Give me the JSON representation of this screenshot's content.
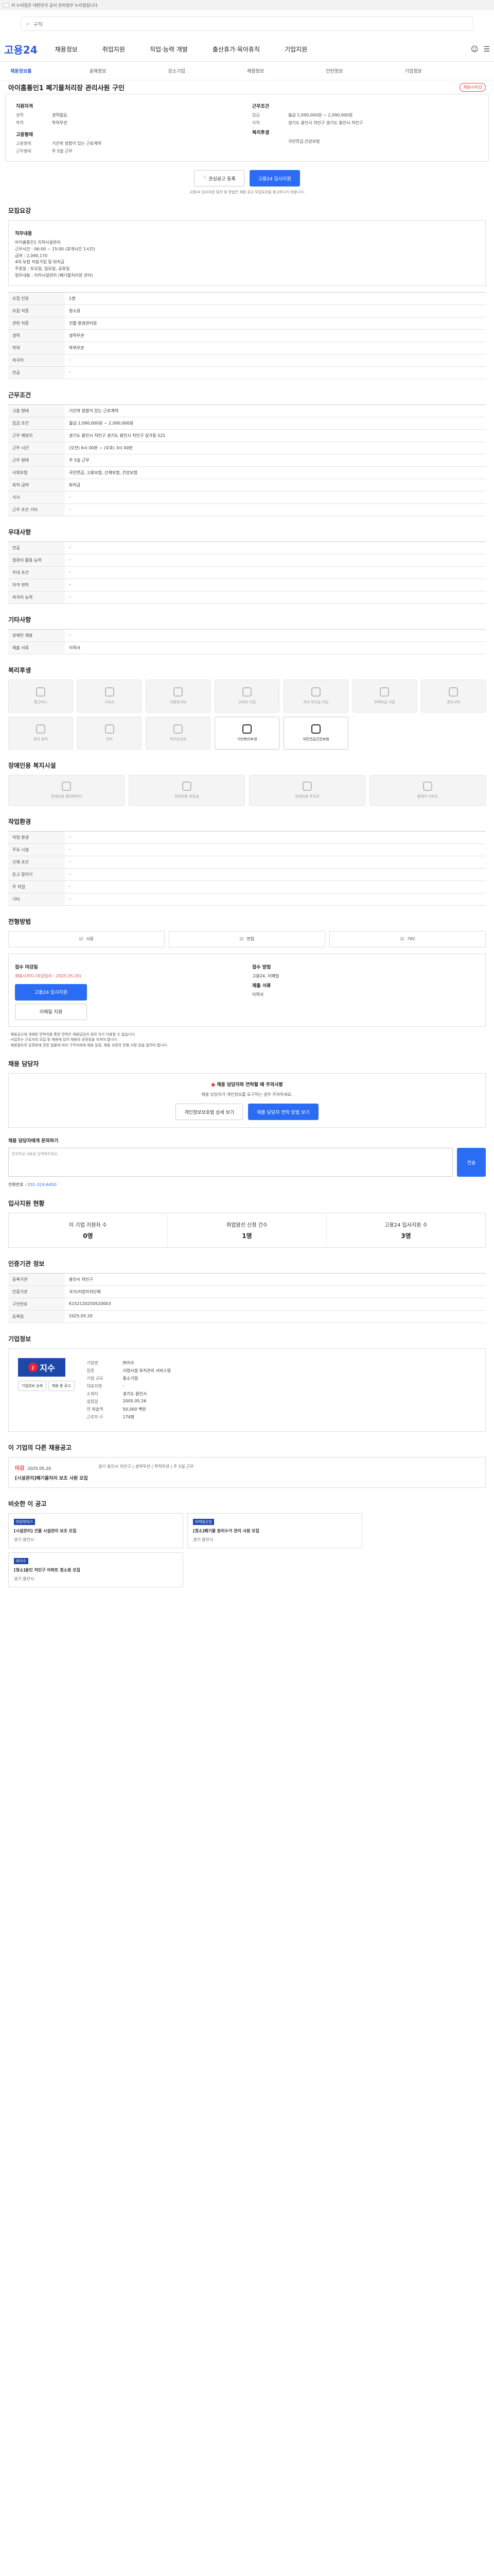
{
  "gov_bar": "이 누리집은 대한민국 공식 전자정부 누리집입니다.",
  "search": {
    "placeholder": "구직"
  },
  "logo": "고용24",
  "nav": [
    "채용정보",
    "취업지원",
    "직업·능력 개발",
    "출산휴가·육아휴직",
    "기업지원"
  ],
  "subnav": [
    "채용정보홈",
    "공채정보",
    "강소기업",
    "체험정보",
    "인턴정보",
    "기업정보"
  ],
  "title": "아이홈통인1 폐기물처리장 관리사원 구인",
  "title_badge": "채용시마감",
  "summary": {
    "left_label": "지원자격",
    "left": [
      [
        "경력",
        "경력없음"
      ],
      [
        "학력",
        "학력무관"
      ],
      [
        "",
        ""
      ]
    ],
    "left2_label": "고용형태",
    "left2": [
      [
        "고용형태",
        "기간의 정함이 있는 근로계약"
      ],
      [
        "근무형태",
        "주 5일 근무"
      ]
    ],
    "right_label": "근무조건",
    "right": [
      [
        "임금",
        "월급 2,090,000원 ~ 2,090,000원"
      ],
      [
        "지역",
        "경기도 용인시 처인구 경기도 용인시 처인구"
      ]
    ],
    "right2_label": "복리후생",
    "right2": [
      [
        "",
        "국민연금,건강보험"
      ]
    ]
  },
  "buttons": {
    "scrap": "관심공고 등록",
    "apply": "고용24 입사지원"
  },
  "apply_note": "고용24 입사지원 절차 및 방법은 채용 공고 모집요강을 참고하시기 바랍니다.",
  "sections": {
    "job_info": "모집요강",
    "conditions": "근무조건",
    "welfare_title": "우대사항",
    "other": "기타사항",
    "benefits": "복리후생",
    "disabled": "장애인용 복지시설",
    "work_env": "작업환경",
    "apply_method": "전형방법",
    "contact": "채용 담당자",
    "status": "입사지원 현황",
    "agency_info": "인증기관 정보",
    "company": "기업정보",
    "same_company": "이 기업의 다른 채용공고",
    "similar": "비슷한 이 공고"
  },
  "job_desc": {
    "label": "직무내용",
    "lines": [
      "아이홈통인1 지하시설관리",
      "근무시간 : 06:00 ~ 15:00 (휴게시간 1시간)",
      "급여 : 2,090,170",
      "4대 보험 적용가입 및 퇴직금",
      "주휴일 : 토요일, 일요일, 공휴일",
      "업무내용 : 지하시설관리 (폐기물처리장 관리)"
    ]
  },
  "job_rows": [
    [
      "모집 인원",
      "1명"
    ],
    [
      "모집 직종",
      "청소원"
    ],
    [
      "관련 직종",
      "건물 환경관리원"
    ],
    [
      "경력",
      "경력무관"
    ],
    [
      "학력",
      "학력무관"
    ],
    [
      "외국어",
      "-"
    ],
    [
      "전공",
      "-"
    ]
  ],
  "cond_rows": [
    [
      "고용 형태",
      "기간의 정함이 있는 근로계약"
    ],
    [
      "임금 조건",
      "월급 2,090,000원 ~ 2,090,000원"
    ],
    [
      "근무 예정지",
      "경기도 용인시 처인구 경기도 용인시 처인구 삼가동 521"
    ],
    [
      "근무 시간",
      "(오전) 6시 00분 ~ (오후) 3시 00분"
    ],
    [
      "근무 형태",
      "주 5일 근무"
    ],
    [
      "사회보험",
      "국민연금, 고용보험, 산재보험, 건강보험"
    ],
    [
      "퇴직 급여",
      "퇴직금"
    ],
    [
      "식사",
      "-"
    ],
    [
      "근무 조건 기타",
      "-"
    ]
  ],
  "pref_rows": [
    [
      "전공",
      "-"
    ],
    [
      "컴퓨터 활용 능력",
      "-"
    ],
    [
      "우대 조건",
      "-"
    ],
    [
      "자격 면허",
      "-"
    ],
    [
      "외국어 능력",
      "-"
    ]
  ],
  "other_rows": [
    [
      "장애인 채용",
      "-"
    ],
    [
      "제출 서류",
      "이력서"
    ]
  ],
  "benefits_tiles": [
    "통근버스",
    "기숙사",
    "차량유지비",
    "교육비 지원",
    "자녀 학자금 지원",
    "주택자금 지원",
    "경조사비",
    "육아 휴직",
    "연차",
    "복지포인트",
    "기타복리후생",
    "국민연금건강보험"
  ],
  "disabled_tiles": [
    "장애인용 엘리베이터",
    "장애인용 화장실",
    "장애인용 주차장",
    "휠체어 리프트"
  ],
  "work_rows": [
    [
      "작업 환경",
      "-"
    ],
    [
      "주요 시설",
      "-"
    ],
    [
      "신체 조건",
      "-"
    ],
    [
      "듣고 말하기",
      "-"
    ],
    [
      "주 작업",
      "-"
    ],
    [
      "기타",
      "-"
    ]
  ],
  "methods": [
    "서류",
    "면접",
    "기타"
  ],
  "apply_info": {
    "deadline_label": "접수 마감일",
    "deadline": "채용시까지 (마감일자 : 2025.05.20)",
    "apply_btn": "고용24 입사지원",
    "email_btn": "이메일 지원",
    "method_label": "접수 방법",
    "method": "고용24, 이메일",
    "docs_label": "제출 서류",
    "docs": "이력서"
  },
  "notices": [
    "· 채용공고에 게재된 연락처를 통한 연락은 채용담당자 외의 자가 이용할 수 없습니다.",
    "· 사업주는 근로자의 모집 및 채용에 있어 채용의 공정성을 지켜야 합니다.",
    "· 채용절차의 공정화에 관한 법률에 따라 구직자에게 채용 일정, 채용 과정의 진행 사항 등을 알려야 합니다."
  ],
  "contact": {
    "warn_title": "채용 담당자와 연락할 때 주의사항",
    "warn": "채용 담당자가 개인정보를 요구하는 경우 주의하세요.",
    "btn1": "개인정보보호법 상세 보기",
    "btn2": "채용 담당자 연락 방법 보기",
    "inq_label": "채용 담당자에게 문의하기",
    "inq_placeholder": "문의하실 내용을 입력해주세요.",
    "inq_btn": "전송",
    "phone_label": "전화번호",
    "phone": "031-324-6450"
  },
  "stats": [
    {
      "label": "이 기업 지원자 수",
      "value": "0명"
    },
    {
      "label": "취업알선 신청 건수",
      "value": "1명"
    },
    {
      "label": "고용24 입사지원 수",
      "value": "3명"
    }
  ],
  "agency": {
    "rows": [
      [
        "등록기관",
        "용인시 처인구"
      ],
      [
        "인증기관",
        "국가/지방자치단체"
      ],
      [
        "구인번호",
        "K152120250520003"
      ],
      [
        "등록일",
        "2025.05.20"
      ]
    ]
  },
  "company": {
    "logo": "지수",
    "rows": [
      [
        "기업명",
        "㈜지수"
      ],
      [
        "업종",
        "사업시설 유지관리 서비스업"
      ],
      [
        "기업 규모",
        "중소기업"
      ],
      [
        "대표자명",
        "-"
      ],
      [
        "소재지",
        "경기도 용인시"
      ],
      [
        "설립일",
        "2005.05.26"
      ],
      [
        "연 매출액",
        "50,000 백만"
      ],
      [
        "근로자 수",
        "174명"
      ]
    ],
    "btns": [
      "기업정보 상세",
      "채용 중 공고"
    ]
  },
  "same_jobs": [
    {
      "status": "마감",
      "date": "2025.05.20",
      "title": "[시설관리]폐기물처리 보조 사원 모집",
      "meta": "경기 용인시 처인구 | 경력무관 | 학력무관 | 주 5일 근무"
    }
  ],
  "similar_jobs": [
    {
      "tag": "㈜원방테크",
      "title": "[시설관리] 건물 시설관리 보조 모집",
      "meta": "경기 용인시"
    },
    {
      "tag": "㈜제일산업",
      "title": "[청소]폐기물 분리수거 관리 사원 모집",
      "meta": "경기 용인시"
    },
    {
      "tag": "㈜지수",
      "title": "[청소]용인 처인구 아파트 청소원 모집",
      "meta": "경기 용인시"
    }
  ],
  "more": "더보기"
}
